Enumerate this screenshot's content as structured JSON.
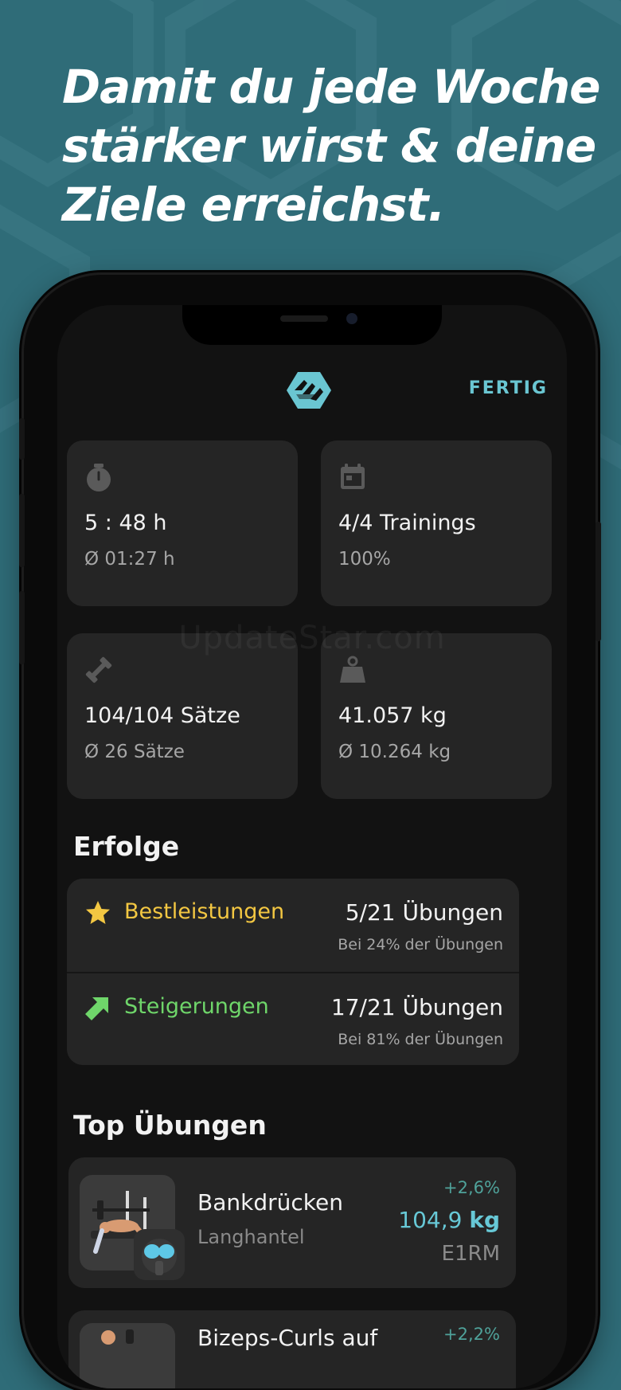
{
  "headline": {
    "line1": "Damit du jede Woche",
    "line2": "stärker wirst & deine",
    "line3": "Ziele erreichst."
  },
  "header": {
    "done_label": "FERTIG"
  },
  "stats": [
    {
      "icon": "stopwatch-icon",
      "main": "5 : 48 h",
      "sub": "Ø 01:27 h"
    },
    {
      "icon": "calendar-icon",
      "main": "4/4 Trainings",
      "sub": "100%"
    },
    {
      "icon": "dumbbell-icon",
      "main": "104/104 Sätze",
      "sub": "Ø 26 Sätze"
    },
    {
      "icon": "weight-icon",
      "main": "41.057 kg",
      "sub": "Ø 10.264 kg"
    }
  ],
  "watermark": "UpdateStar.com",
  "achievements": {
    "title": "Erfolge",
    "items": [
      {
        "icon": "star-icon",
        "label": "Bestleistungen",
        "color": "#f3c742",
        "value": "5/21 Übungen",
        "sub": "Bei 24% der Übungen"
      },
      {
        "icon": "arrow-up-right-icon",
        "label": "Steigerungen",
        "color": "#6fd66a",
        "value": "17/21 Übungen",
        "sub": "Bei 81% der Übungen"
      }
    ]
  },
  "top_exercises": {
    "title": "Top Übungen",
    "items": [
      {
        "name": "Bankdrücken",
        "equipment": "Langhantel",
        "change": "+2,6%",
        "weight_value": "104,9",
        "weight_unit": "kg",
        "metric": "E1RM"
      },
      {
        "name": "Bizeps-Curls auf",
        "change": "+2,2%"
      }
    ]
  },
  "colors": {
    "accent": "#6ac6d2",
    "background": "#2f6c78",
    "card": "#252525"
  }
}
